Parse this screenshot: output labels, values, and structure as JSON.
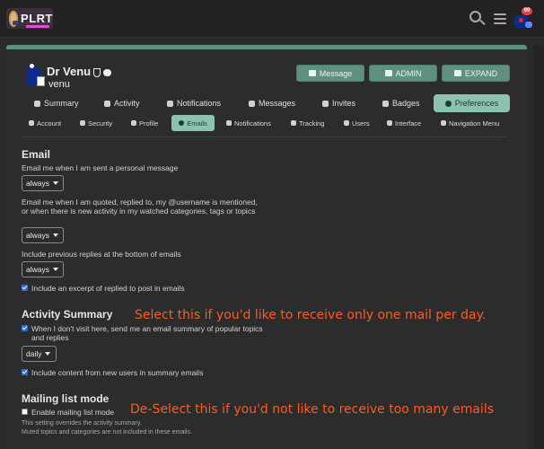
{
  "header": {
    "logo_text": "PLRT",
    "notification_count": "99"
  },
  "profile": {
    "name": "Dr Venu",
    "username": "venu",
    "buttons": {
      "message": "Message",
      "admin": "ADMIN",
      "expand": "EXPAND"
    }
  },
  "nav_primary": [
    {
      "label": "Summary"
    },
    {
      "label": "Activity"
    },
    {
      "label": "Notifications"
    },
    {
      "label": "Messages"
    },
    {
      "label": "Invites"
    },
    {
      "label": "Badges"
    },
    {
      "label": "Preferences",
      "active": true
    }
  ],
  "nav_secondary": [
    {
      "label": "Account"
    },
    {
      "label": "Security"
    },
    {
      "label": "Profile"
    },
    {
      "label": "Emails",
      "active": true
    },
    {
      "label": "Notifications"
    },
    {
      "label": "Tracking"
    },
    {
      "label": "Users"
    },
    {
      "label": "Interface"
    },
    {
      "label": "Navigation Menu"
    }
  ],
  "email": {
    "title": "Email",
    "pm_label": "Email me when I am sent a personal message",
    "pm_value": "always",
    "quoted_label": "Email me when I am quoted, replied to, my @username is mentioned, or when there is new activity in my watched categories, tags or topics",
    "quoted_value": "always",
    "previous_label": "Include previous replies at the bottom of emails",
    "previous_value": "always",
    "excerpt_label": "Include an excerpt of replied to post in emails"
  },
  "activity": {
    "title": "Activity Summary",
    "digest_label": "When I don't visit here, send me an email summary of popular topics and replies",
    "digest_value": "daily",
    "new_users_label": "Include content from new users in summary emails"
  },
  "mailing": {
    "title": "Mailing list mode",
    "enable_label": "Enable mailing list mode",
    "note1": "This setting overrides the activity summary.",
    "note2": "Muted topics and categories are not included in these emails."
  },
  "annotations": {
    "activity": "Select this if you'd like to receive only one mail per day.",
    "mailing": "De-Select this if you'd not like to receive too many emails"
  },
  "colors": {
    "accent": "#5f8f80",
    "active_tab": "#8ec2b0",
    "annotation": "#ff5a1f",
    "checkbox": "#2d6fd6"
  }
}
